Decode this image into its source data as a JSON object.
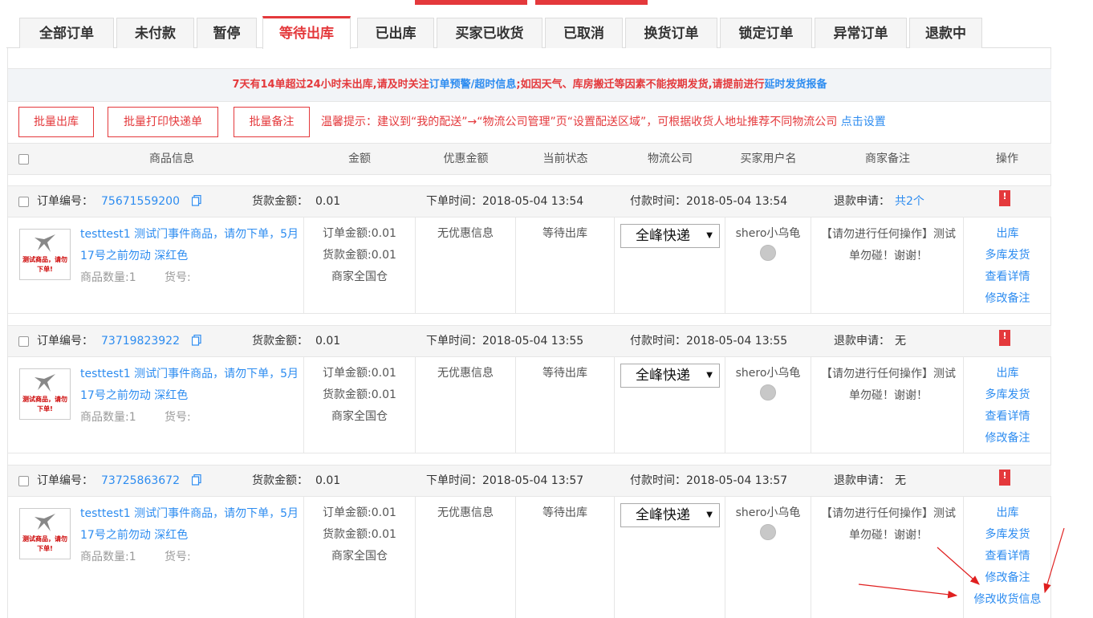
{
  "tabs": [
    "全部订单",
    "未付款",
    "暂停",
    "等待出库",
    "已出库",
    "买家已收货",
    "已取消",
    "换货订单",
    "锁定订单",
    "异常订单",
    "退款中"
  ],
  "active_tab": "等待出库",
  "notice": {
    "part1": "7天有14单超过24小时未出库,请及时关注",
    "link1": "订单预警/超时信息",
    "part2": ";如因天气、库房搬迁等因素不能按期发货,请提前进行",
    "link2": "延时发货报备"
  },
  "actions": {
    "batch_ship": "批量出库",
    "batch_print": "批量打印快递单",
    "batch_note": "批量备注"
  },
  "hint": {
    "text": "温馨提示：建议到“我的配送”→“物流公司管理”页“设置配送区域”，可根据收货人地址推荐不同物流公司",
    "link": "点击设置"
  },
  "columns": [
    "商品信息",
    "金额",
    "优惠金额",
    "当前状态",
    "物流公司",
    "买家用户名",
    "商家备注",
    "操作"
  ],
  "orders": [
    {
      "order_label": "订单编号：",
      "order_no": "75671559200",
      "payment_label": "货款金额：",
      "payment": "0.01",
      "order_time": "下单时间：2018-05-04 13:54",
      "pay_time": "付款时间：2018-05-04 13:54",
      "refund_label": "退款申请：",
      "refund": "共2个",
      "thumb_text": "测试商品，请勿下单!",
      "goods_name": "testtest1 测试门事件商品，请勿下单，5月17号之前勿动 深红色",
      "qty": "商品数量:1",
      "sku": "货号:",
      "amount_order": "订单金额:0.01",
      "amount_goods": "货款金额:0.01",
      "warehouse": "商家全国仓",
      "discount": "无优惠信息",
      "status": "等待出库",
      "logistics": "全峰快递",
      "buyer": "shero小乌龟",
      "note": "【请勿进行任何操作】测试单勿碰！谢谢！",
      "ops": [
        "出库",
        "多库发货",
        "查看详情",
        "修改备注"
      ]
    },
    {
      "order_label": "订单编号：",
      "order_no": "73719823922",
      "payment_label": "货款金额：",
      "payment": "0.01",
      "order_time": "下单时间：2018-05-04 13:55",
      "pay_time": "付款时间：2018-05-04 13:55",
      "refund_label": "退款申请：",
      "refund": "无",
      "thumb_text": "测试商品，请勿下单!",
      "goods_name": "testtest1 测试门事件商品，请勿下单，5月17号之前勿动 深红色",
      "qty": "商品数量:1",
      "sku": "货号:",
      "amount_order": "订单金额:0.01",
      "amount_goods": "货款金额:0.01",
      "warehouse": "商家全国仓",
      "discount": "无优惠信息",
      "status": "等待出库",
      "logistics": "全峰快递",
      "buyer": "shero小乌龟",
      "note": "【请勿进行任何操作】测试单勿碰！谢谢！",
      "ops": [
        "出库",
        "多库发货",
        "查看详情",
        "修改备注"
      ]
    },
    {
      "order_label": "订单编号：",
      "order_no": "73725863672",
      "payment_label": "货款金额：",
      "payment": "0.01",
      "order_time": "下单时间：2018-05-04 13:57",
      "pay_time": "付款时间：2018-05-04 13:57",
      "refund_label": "退款申请：",
      "refund": "无",
      "thumb_text": "测试商品，请勿下单!",
      "goods_name": "testtest1 测试门事件商品，请勿下单，5月17号之前勿动 深红色",
      "qty": "商品数量:1",
      "sku": "货号:",
      "amount_order": "订单金额:0.01",
      "amount_goods": "货款金额:0.01",
      "warehouse": "商家全国仓",
      "discount": "无优惠信息",
      "status": "等待出库",
      "logistics": "全峰快递",
      "buyer": "shero小乌龟",
      "note": "【请勿进行任何操作】测试单勿碰！谢谢！",
      "ops": [
        "出库",
        "多库发货",
        "查看详情",
        "修改备注",
        "修改收货信息"
      ]
    }
  ],
  "colors": {
    "accent": "#e4393c",
    "link": "#2d8cf0",
    "annotation": "#e02020"
  }
}
